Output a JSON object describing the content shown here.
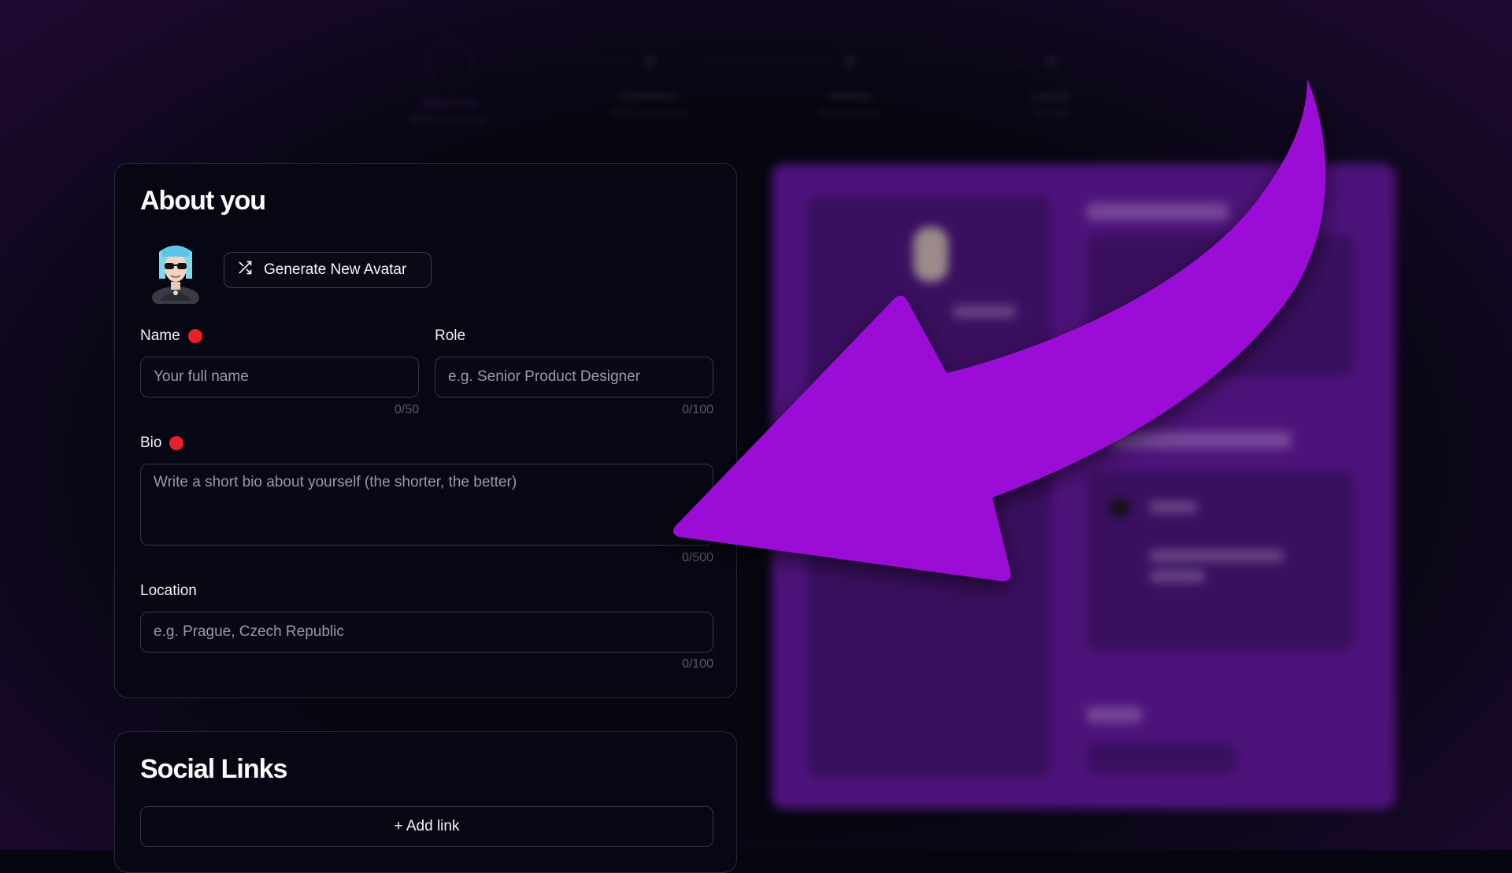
{
  "stepper": {
    "steps": [
      {
        "title": "About You",
        "subtitle": "Basic info & bio"
      },
      {
        "title": "Experience",
        "subtitle": "Work & timeline"
      },
      {
        "title": "Settings",
        "subtitle": "Preferences"
      },
      {
        "title": "Launch",
        "subtitle": "Go live"
      }
    ]
  },
  "about": {
    "heading": "About you",
    "generate_button": "Generate New Avatar",
    "name_label": "Name",
    "name_placeholder": "Your full name",
    "name_count": "0/50",
    "role_label": "Role",
    "role_placeholder": "e.g. Senior Product Designer",
    "role_count": "0/100",
    "bio_label": "Bio",
    "bio_placeholder": "Write a short bio about yourself (the shorter, the better)",
    "bio_count": "0/500",
    "location_label": "Location",
    "location_placeholder": "e.g. Prague, Czech Republic",
    "location_count": "0/100"
  },
  "social": {
    "heading": "Social Links",
    "add_link": "+ Add link"
  },
  "colors": {
    "background": "#060611",
    "preview_purple": "#4d137a",
    "arrow": "#9b0fd6",
    "required_dot": "#e8202a"
  },
  "icons": [
    "shuffle-icon",
    "avatar-illustration",
    "arrow-pointer"
  ]
}
